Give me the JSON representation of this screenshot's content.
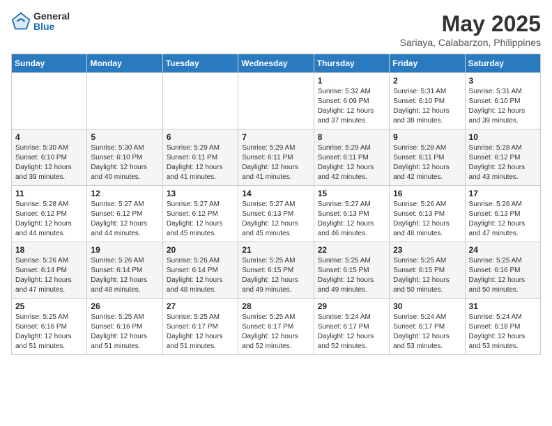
{
  "header": {
    "logo_general": "General",
    "logo_blue": "Blue",
    "month_year": "May 2025",
    "location": "Sariaya, Calabarzon, Philippines"
  },
  "weekdays": [
    "Sunday",
    "Monday",
    "Tuesday",
    "Wednesday",
    "Thursday",
    "Friday",
    "Saturday"
  ],
  "weeks": [
    [
      {
        "day": "",
        "info": ""
      },
      {
        "day": "",
        "info": ""
      },
      {
        "day": "",
        "info": ""
      },
      {
        "day": "",
        "info": ""
      },
      {
        "day": "1",
        "info": "Sunrise: 5:32 AM\nSunset: 6:09 PM\nDaylight: 12 hours\nand 37 minutes."
      },
      {
        "day": "2",
        "info": "Sunrise: 5:31 AM\nSunset: 6:10 PM\nDaylight: 12 hours\nand 38 minutes."
      },
      {
        "day": "3",
        "info": "Sunrise: 5:31 AM\nSunset: 6:10 PM\nDaylight: 12 hours\nand 39 minutes."
      }
    ],
    [
      {
        "day": "4",
        "info": "Sunrise: 5:30 AM\nSunset: 6:10 PM\nDaylight: 12 hours\nand 39 minutes."
      },
      {
        "day": "5",
        "info": "Sunrise: 5:30 AM\nSunset: 6:10 PM\nDaylight: 12 hours\nand 40 minutes."
      },
      {
        "day": "6",
        "info": "Sunrise: 5:29 AM\nSunset: 6:11 PM\nDaylight: 12 hours\nand 41 minutes."
      },
      {
        "day": "7",
        "info": "Sunrise: 5:29 AM\nSunset: 6:11 PM\nDaylight: 12 hours\nand 41 minutes."
      },
      {
        "day": "8",
        "info": "Sunrise: 5:29 AM\nSunset: 6:11 PM\nDaylight: 12 hours\nand 42 minutes."
      },
      {
        "day": "9",
        "info": "Sunrise: 5:28 AM\nSunset: 6:11 PM\nDaylight: 12 hours\nand 42 minutes."
      },
      {
        "day": "10",
        "info": "Sunrise: 5:28 AM\nSunset: 6:12 PM\nDaylight: 12 hours\nand 43 minutes."
      }
    ],
    [
      {
        "day": "11",
        "info": "Sunrise: 5:28 AM\nSunset: 6:12 PM\nDaylight: 12 hours\nand 44 minutes."
      },
      {
        "day": "12",
        "info": "Sunrise: 5:27 AM\nSunset: 6:12 PM\nDaylight: 12 hours\nand 44 minutes."
      },
      {
        "day": "13",
        "info": "Sunrise: 5:27 AM\nSunset: 6:12 PM\nDaylight: 12 hours\nand 45 minutes."
      },
      {
        "day": "14",
        "info": "Sunrise: 5:27 AM\nSunset: 6:13 PM\nDaylight: 12 hours\nand 45 minutes."
      },
      {
        "day": "15",
        "info": "Sunrise: 5:27 AM\nSunset: 6:13 PM\nDaylight: 12 hours\nand 46 minutes."
      },
      {
        "day": "16",
        "info": "Sunrise: 5:26 AM\nSunset: 6:13 PM\nDaylight: 12 hours\nand 46 minutes."
      },
      {
        "day": "17",
        "info": "Sunrise: 5:26 AM\nSunset: 6:13 PM\nDaylight: 12 hours\nand 47 minutes."
      }
    ],
    [
      {
        "day": "18",
        "info": "Sunrise: 5:26 AM\nSunset: 6:14 PM\nDaylight: 12 hours\nand 47 minutes."
      },
      {
        "day": "19",
        "info": "Sunrise: 5:26 AM\nSunset: 6:14 PM\nDaylight: 12 hours\nand 48 minutes."
      },
      {
        "day": "20",
        "info": "Sunrise: 5:26 AM\nSunset: 6:14 PM\nDaylight: 12 hours\nand 48 minutes."
      },
      {
        "day": "21",
        "info": "Sunrise: 5:25 AM\nSunset: 6:15 PM\nDaylight: 12 hours\nand 49 minutes."
      },
      {
        "day": "22",
        "info": "Sunrise: 5:25 AM\nSunset: 6:15 PM\nDaylight: 12 hours\nand 49 minutes."
      },
      {
        "day": "23",
        "info": "Sunrise: 5:25 AM\nSunset: 6:15 PM\nDaylight: 12 hours\nand 50 minutes."
      },
      {
        "day": "24",
        "info": "Sunrise: 5:25 AM\nSunset: 6:16 PM\nDaylight: 12 hours\nand 50 minutes."
      }
    ],
    [
      {
        "day": "25",
        "info": "Sunrise: 5:25 AM\nSunset: 6:16 PM\nDaylight: 12 hours\nand 51 minutes."
      },
      {
        "day": "26",
        "info": "Sunrise: 5:25 AM\nSunset: 6:16 PM\nDaylight: 12 hours\nand 51 minutes."
      },
      {
        "day": "27",
        "info": "Sunrise: 5:25 AM\nSunset: 6:17 PM\nDaylight: 12 hours\nand 51 minutes."
      },
      {
        "day": "28",
        "info": "Sunrise: 5:25 AM\nSunset: 6:17 PM\nDaylight: 12 hours\nand 52 minutes."
      },
      {
        "day": "29",
        "info": "Sunrise: 5:24 AM\nSunset: 6:17 PM\nDaylight: 12 hours\nand 52 minutes."
      },
      {
        "day": "30",
        "info": "Sunrise: 5:24 AM\nSunset: 6:17 PM\nDaylight: 12 hours\nand 53 minutes."
      },
      {
        "day": "31",
        "info": "Sunrise: 5:24 AM\nSunset: 6:18 PM\nDaylight: 12 hours\nand 53 minutes."
      }
    ]
  ]
}
